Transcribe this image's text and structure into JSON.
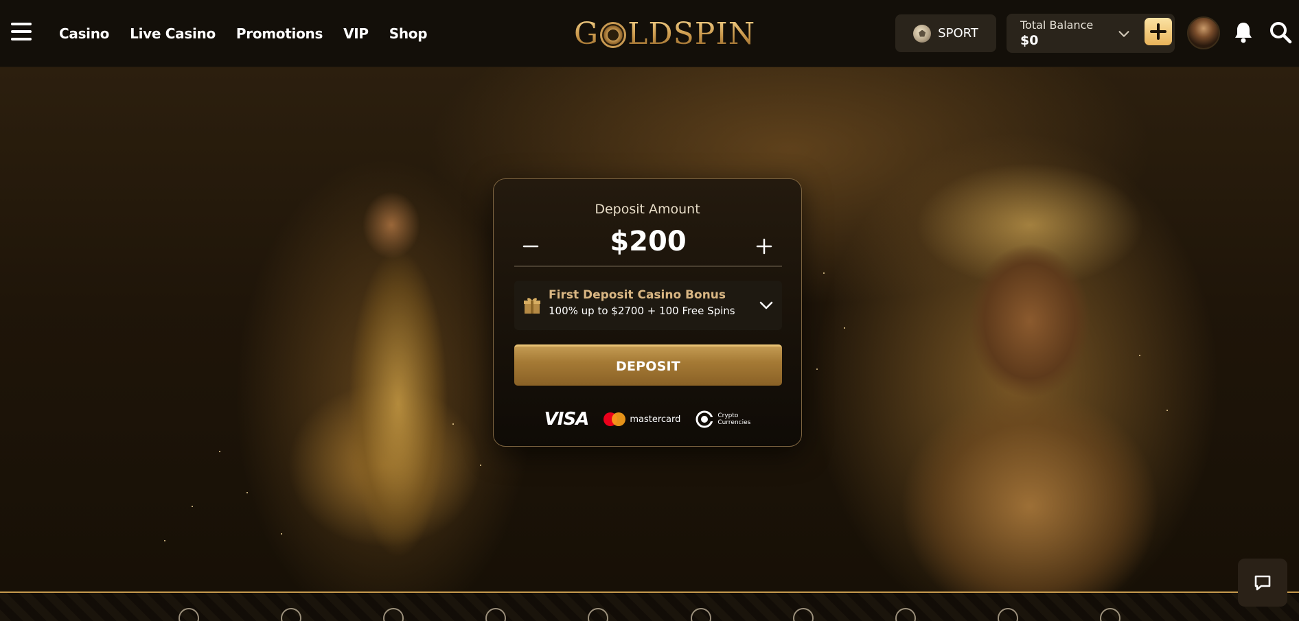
{
  "header": {
    "nav": [
      "Casino",
      "Live Casino",
      "Promotions",
      "VIP",
      "Shop"
    ],
    "logo": "GoldSpin",
    "sport_label": "SPORT",
    "balance_title": "Total Balance",
    "balance_amount": "$0"
  },
  "deposit": {
    "label": "Deposit Amount",
    "amount": "$200",
    "bonus_title": "First Deposit Casino Bonus",
    "bonus_subtitle": "100% up to $2700 + 100 Free Spins",
    "button_label": "DEPOSIT",
    "payment_visa": "VISA",
    "payment_mastercard": "mastercard",
    "payment_crypto_line1": "Crypto",
    "payment_crypto_line2": "Currencies"
  },
  "colors": {
    "accent_gold": "#c39a52",
    "header_bg": "#130f09",
    "bonus_title": "#d9b683"
  },
  "icons": {
    "menu": "hamburger-icon",
    "sport": "soccer-ball-icon",
    "balance_toggle": "chevron-down-icon",
    "add_funds": "plus-icon",
    "notifications": "bell-icon",
    "search": "search-icon",
    "bonus": "gift-icon",
    "chat": "chat-icon"
  }
}
